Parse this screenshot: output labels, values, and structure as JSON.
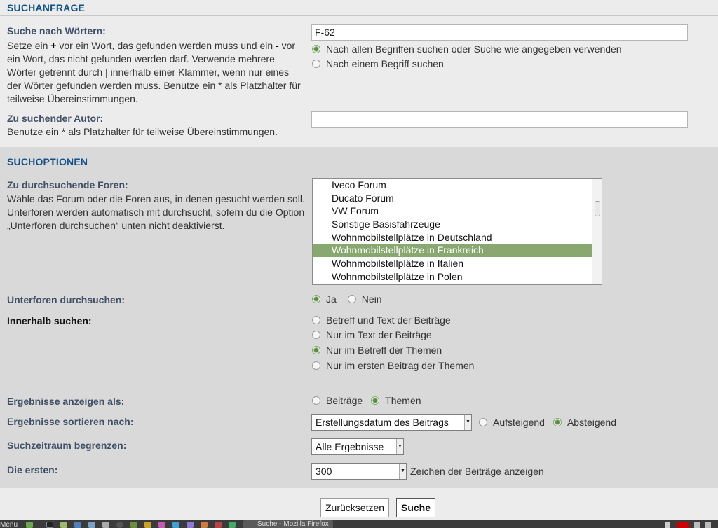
{
  "query": {
    "header": "SUCHANFRAGE",
    "words_label": "Suche nach Wörtern:",
    "words_desc_1": "Setze ein ",
    "words_plus": "+",
    "words_desc_2": " vor ein Wort, das gefunden werden muss und ein ",
    "words_minus": "-",
    "words_desc_3": " vor ein Wort, das nicht gefunden werden darf. Verwende mehrere Wörter getrennt durch | innerhalb einer Klammer, wenn nur eines der Wörter gefunden werden muss. Benutze ein * als Platzhalter für teilweise Übereinstimmungen.",
    "words_value": "F-62",
    "terms_all": "Nach allen Begriffen suchen oder Suche wie angegeben verwenden",
    "terms_any": "Nach einem Begriff suchen",
    "author_label": "Zu suchender Autor:",
    "author_desc": "Benutze ein * als Platzhalter für teilweise Übereinstimmungen.",
    "author_value": ""
  },
  "options": {
    "header": "SUCHOPTIONEN",
    "forums_label": "Zu durchsuchende Foren:",
    "forums_desc": "Wähle das Forum oder die Foren aus, in denen gesucht werden soll. Unterforen werden automatisch mit durchsucht, sofern du die Option „Unterforen durchsuchen“ unten nicht deaktivierst.",
    "forums": [
      {
        "label": "Iveco Forum",
        "selected": false
      },
      {
        "label": "Ducato Forum",
        "selected": false
      },
      {
        "label": "VW Forum",
        "selected": false
      },
      {
        "label": "Sonstige Basisfahrzeuge",
        "selected": false
      },
      {
        "label": "Wohnmobilstellplätze in Deutschland",
        "selected": false
      },
      {
        "label": "Wohnmobilstellplätze in Frankreich",
        "selected": true
      },
      {
        "label": "Wohnmobilstellplätze in Italien",
        "selected": false
      },
      {
        "label": "Wohnmobilstellplätze in Polen",
        "selected": false
      }
    ],
    "subforums_label": "Unterforen durchsuchen:",
    "subforums_yes": "Ja",
    "subforums_no": "Nein",
    "within_label": "Innerhalb suchen:",
    "within_1": "Betreff und Text der Beiträge",
    "within_2": "Nur im Text der Beiträge",
    "within_3": "Nur im Betreff der Themen",
    "within_4": "Nur im ersten Beitrag der Themen",
    "display_label": "Ergebnisse anzeigen als:",
    "display_posts": "Beiträge",
    "display_topics": "Themen",
    "sort_label": "Ergebnisse sortieren nach:",
    "sort_value": "Erstellungsdatum des Beitrags",
    "sort_asc": "Aufsteigend",
    "sort_desc": "Absteigend",
    "time_label": "Suchzeitraum begrenzen:",
    "time_value": "Alle Ergebnisse",
    "first_label": "Die ersten:",
    "first_value": "300",
    "first_suffix": "Zeichen der Beiträge anzeigen"
  },
  "buttons": {
    "reset": "Zurücksetzen",
    "search": "Suche"
  },
  "taskbar": {
    "menu": "Menü",
    "window_title": "Suche - Mozilla Firefox"
  },
  "colors": {
    "header_blue": "#105289",
    "label_slate": "#425067",
    "selection_green": "#89a870"
  }
}
